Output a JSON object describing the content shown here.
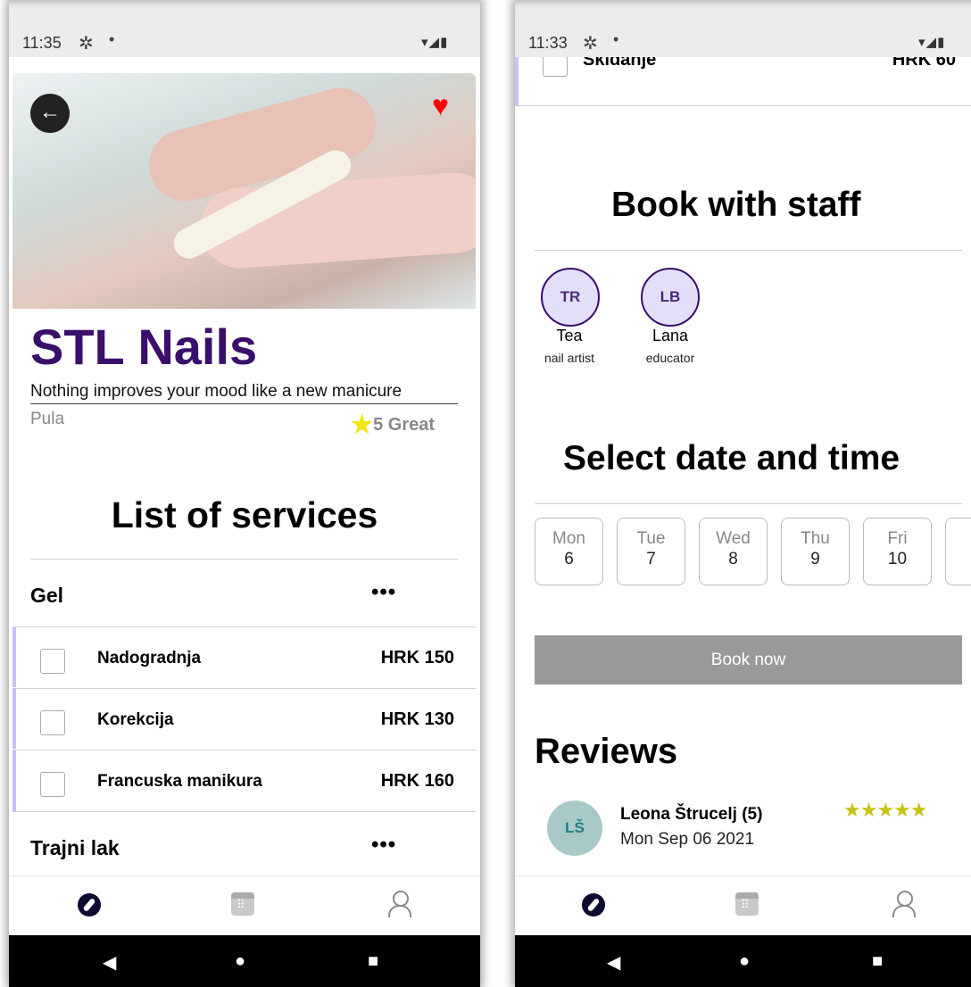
{
  "left": {
    "status": {
      "time": "11:35",
      "gear": "✲",
      "dot": "•",
      "icons": "▾◢▮"
    },
    "shop": {
      "name": "STL Nails",
      "tagline": "Nothing improves your mood like a new manicure",
      "city": "Pula",
      "rating_text": "5 Great"
    },
    "services_title": "List of services",
    "categories": [
      {
        "name": "Gel",
        "more": "•••"
      },
      {
        "name": "Trajni lak",
        "more": "•••"
      }
    ],
    "services": [
      {
        "name": "Nadogradnja",
        "price": "HRK 150"
      },
      {
        "name": "Korekcija",
        "price": "HRK 130"
      },
      {
        "name": "Francuska manikura",
        "price": "HRK 160"
      }
    ],
    "icons": {
      "back": "←",
      "favorite": "♥",
      "star": "★"
    }
  },
  "right": {
    "status": {
      "time": "11:33",
      "gear": "✲",
      "dot": "•",
      "icons": "▾◢▮"
    },
    "partial_service": {
      "name": "Skidanje",
      "price": "HRK 60"
    },
    "staff_title": "Book with staff",
    "staff": [
      {
        "initials": "TR",
        "name": "Tea",
        "role": "nail artist"
      },
      {
        "initials": "LB",
        "name": "Lana",
        "role": "educator"
      }
    ],
    "date_title": "Select date and time",
    "days": [
      {
        "name": "Mon",
        "date": "6"
      },
      {
        "name": "Tue",
        "date": "7"
      },
      {
        "name": "Wed",
        "date": "8"
      },
      {
        "name": "Thu",
        "date": "9"
      },
      {
        "name": "Fri",
        "date": "10"
      }
    ],
    "book_label": "Book now",
    "reviews_title": "Reviews",
    "review": {
      "initials": "LŠ",
      "name": "Leona Štrucelj (5)",
      "date": "Mon Sep 06 2021",
      "stars": "★★★★★"
    }
  },
  "nav": {
    "back": "◀",
    "home": "●",
    "recent": "■"
  }
}
